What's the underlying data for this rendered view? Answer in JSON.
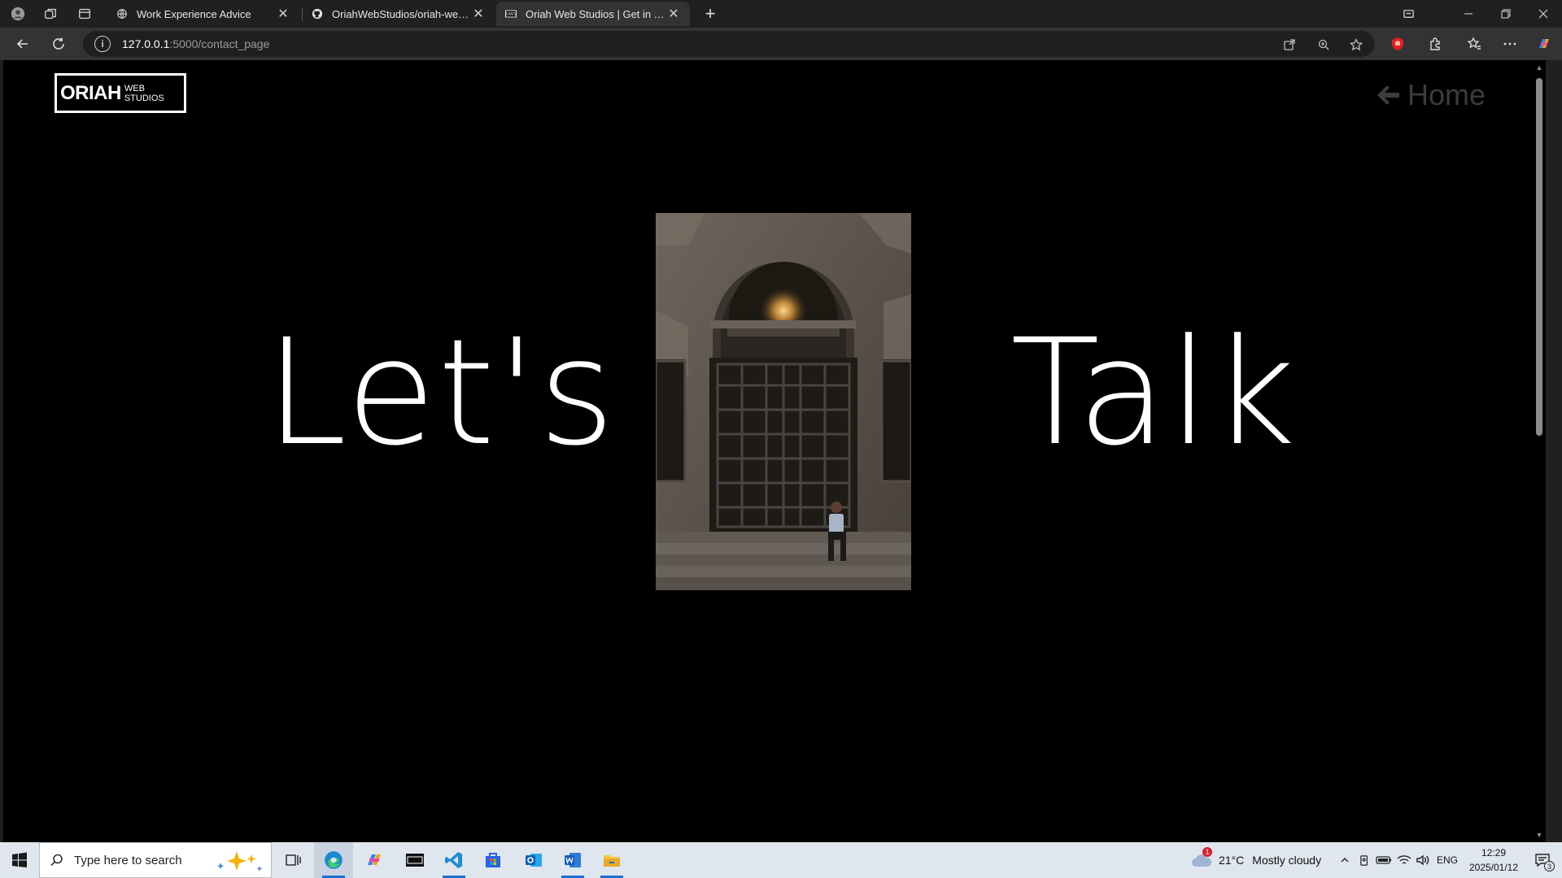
{
  "browser": {
    "tabs": [
      {
        "title": "Work Experience Advice",
        "active": false
      },
      {
        "title": "OriahWebStudios/oriah-web-stud",
        "active": false
      },
      {
        "title": "Oriah Web Studios | Get in Touch",
        "active": true
      }
    ],
    "url": {
      "host": "127.0.0.1",
      "path": ":5000/contact_page"
    },
    "favicon_text": "OWS"
  },
  "page": {
    "logo_main": "ORIAH",
    "logo_sub": "WEB STUDIOS",
    "home_label": "Home",
    "hero_left": "Let's",
    "hero_right": "Talk",
    "photo_alt": "Man sitting on steps in front of an arched doorway",
    "colors": {
      "background": "#000000",
      "text": "#ffffff",
      "home_link": "#3c3c3c"
    }
  },
  "taskbar": {
    "search_placeholder": "Type here to search",
    "weather_temp": "21°C",
    "weather_text": "Mostly cloudy",
    "language": "ENG",
    "time": "12:29",
    "date": "2025/01/12",
    "weather_badge": "1",
    "notification_count": "3"
  }
}
